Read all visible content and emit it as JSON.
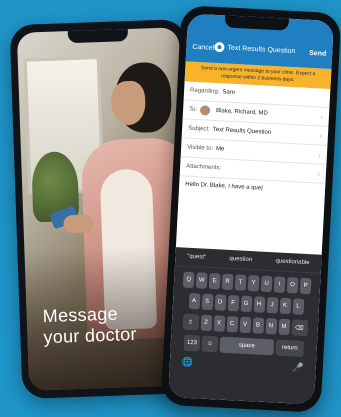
{
  "promo": {
    "line1": "Message",
    "line2": "your doctor"
  },
  "compose": {
    "cancel_label": "Cancel",
    "title": "Text Results Question",
    "send_label": "Send",
    "banner": "Send a non-urgent message to your clinic. Expect a response within 2 business days.",
    "fields": [
      {
        "label": "Regarding:",
        "value": "Sam"
      },
      {
        "label": "To:",
        "value": "Blake, Richard, MD"
      },
      {
        "label": "Subject:",
        "value": "Text Results Question"
      },
      {
        "label": "Visible to:",
        "value": "Me"
      },
      {
        "label": "Attachments:",
        "value": ""
      }
    ],
    "message_body": "Hello Dr. Blake, I have a que|"
  },
  "keyboard": {
    "suggestions": [
      "\"quest\"",
      "question",
      "questionable"
    ],
    "row1": [
      "Q",
      "W",
      "E",
      "R",
      "T",
      "Y",
      "U",
      "I",
      "O",
      "P"
    ],
    "row2": [
      "A",
      "S",
      "D",
      "F",
      "G",
      "H",
      "J",
      "K",
      "L"
    ],
    "row3": [
      "Z",
      "X",
      "C",
      "V",
      "B",
      "N",
      "M"
    ],
    "shift_glyph": "⇧",
    "delete_glyph": "⌫",
    "numbers_label": "123",
    "emoji_glyph": "☺",
    "space_label": "space",
    "return_label": "return",
    "globe_glyph": "🌐",
    "mic_glyph": "🎤"
  }
}
